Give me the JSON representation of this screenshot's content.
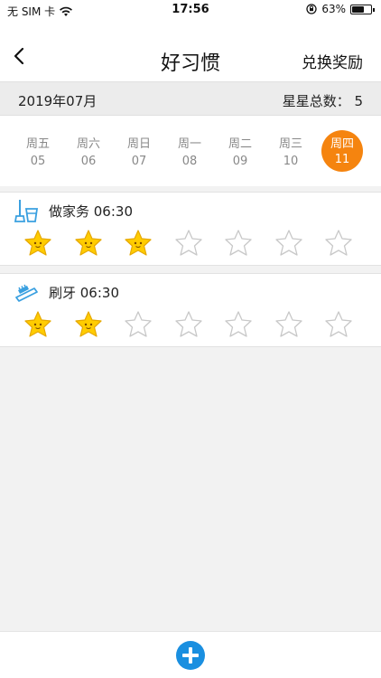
{
  "status_bar": {
    "carrier": "无 SIM 卡",
    "time": "17:56",
    "battery": "63%",
    "battery_level": 0.63
  },
  "nav": {
    "title": "好习惯",
    "right_action": "兑换奖励"
  },
  "summary": {
    "month": "2019年07月",
    "total_stars": "星星总数： 5"
  },
  "week": [
    {
      "weekday": "周五",
      "date": "05",
      "active": false
    },
    {
      "weekday": "周六",
      "date": "06",
      "active": false
    },
    {
      "weekday": "周日",
      "date": "07",
      "active": false
    },
    {
      "weekday": "周一",
      "date": "08",
      "active": false
    },
    {
      "weekday": "周二",
      "date": "09",
      "active": false
    },
    {
      "weekday": "周三",
      "date": "10",
      "active": false
    },
    {
      "weekday": "周四",
      "date": "11",
      "active": true
    }
  ],
  "habits": [
    {
      "label": "做家务 06:30",
      "icon": "chores-icon",
      "stars_filled": 3,
      "stars_total": 7
    },
    {
      "label": "刷牙 06:30",
      "icon": "toothbrush-icon",
      "stars_filled": 2,
      "stars_total": 7
    }
  ],
  "colors": {
    "accent": "#f5840f",
    "star_fill": "#ffcc00",
    "icon_blue": "#3aa0e0",
    "add_button": "#1a8fe0"
  }
}
